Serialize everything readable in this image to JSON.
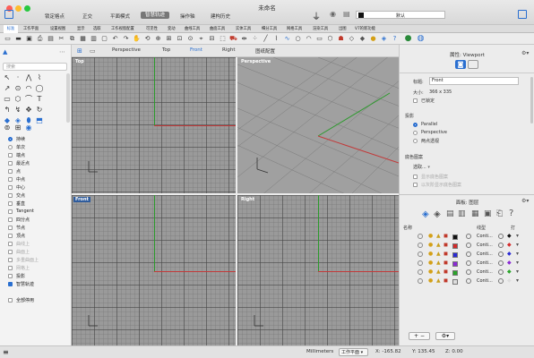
{
  "window": {
    "title": "未命名"
  },
  "modes": [
    "锁定格点",
    "正交",
    "平面模式",
    "智慧轨迹",
    "操作轴",
    "建构历史"
  ],
  "layer_default": "默认",
  "toolbar_tabs": [
    "标准",
    "工作平面",
    "设置视图",
    "显示",
    "选取",
    "工作视窗配置",
    "可见性",
    "变动",
    "曲线工具",
    "曲面工具",
    "实体工具",
    "细分工具",
    "网格工具",
    "渲染工具",
    "出图",
    "V7的新功能"
  ],
  "left": {
    "search_placeholder": "搜索",
    "osnaps": [
      {
        "label": "持续",
        "type": "radio",
        "on": true,
        "disabled": false
      },
      {
        "label": "单次",
        "type": "radio",
        "on": false,
        "disabled": false
      },
      {
        "label": "端点",
        "type": "check",
        "on": false,
        "disabled": false
      },
      {
        "label": "最近点",
        "type": "check",
        "on": false,
        "disabled": false
      },
      {
        "label": "点",
        "type": "check",
        "on": false,
        "disabled": false
      },
      {
        "label": "中点",
        "type": "check",
        "on": false,
        "disabled": false
      },
      {
        "label": "中心",
        "type": "check",
        "on": false,
        "disabled": false
      },
      {
        "label": "交点",
        "type": "check",
        "on": false,
        "disabled": false
      },
      {
        "label": "垂直",
        "type": "check",
        "on": false,
        "disabled": false
      },
      {
        "label": "Tangent",
        "type": "check",
        "on": false,
        "disabled": false
      },
      {
        "label": "四分点",
        "type": "check",
        "on": false,
        "disabled": false
      },
      {
        "label": "节点",
        "type": "check",
        "on": false,
        "disabled": false
      },
      {
        "label": "顶点",
        "type": "check",
        "on": false,
        "disabled": false
      },
      {
        "label": "曲线上",
        "type": "check",
        "on": false,
        "disabled": true
      },
      {
        "label": "曲面上",
        "type": "check",
        "on": false,
        "disabled": true
      },
      {
        "label": "多重曲面上",
        "type": "check",
        "on": false,
        "disabled": true
      },
      {
        "label": "网格上",
        "type": "check",
        "on": false,
        "disabled": true
      },
      {
        "label": "投影",
        "type": "check",
        "on": false,
        "disabled": false
      },
      {
        "label": "智慧轨迹",
        "type": "check",
        "on": true,
        "disabled": false
      },
      {
        "label": "全部停用",
        "type": "check",
        "on": false,
        "disabled": false
      }
    ]
  },
  "viewport_tabs": [
    "Perspective",
    "Top",
    "Front",
    "Right",
    "图纸配置"
  ],
  "active_viewport_tab": "Front",
  "viewports": {
    "top": "Top",
    "perspective": "Perspective",
    "front": "Front",
    "right": "Right"
  },
  "props": {
    "title": "属性: Viewport",
    "title_label": "标题:",
    "title_value": "Front",
    "size_label": "大小:",
    "size_value": "366 x 335",
    "locked": "已锁定",
    "projection_heading": "投影",
    "projections": [
      "Parallel",
      "Perspective",
      "两点透视"
    ],
    "projection_selected": "Parallel",
    "wallpaper_heading": "底色图案",
    "wallpaper_button": "选取...",
    "wallpaper_opts": [
      "显示底色图案",
      "以灰阶显示底色图案"
    ]
  },
  "layers": {
    "title": "面板: 图层",
    "col_name": "名称",
    "col_linetype": "线型",
    "col_print": "打",
    "rows": [
      {
        "linetype": "Conti...",
        "color": "#111111"
      },
      {
        "linetype": "Conti...",
        "color": "#d42a2a"
      },
      {
        "linetype": "Conti...",
        "color": "#2a2ad4"
      },
      {
        "linetype": "Conti...",
        "color": "#8a2ad4"
      },
      {
        "linetype": "Conti...",
        "color": "#2aa42a"
      },
      {
        "linetype": "Conti...",
        "color": "#dddddd"
      }
    ],
    "add": "+",
    "remove": "−"
  },
  "status": {
    "units": "Millimeters",
    "cplane": "工作平面",
    "x": "X: -165.82",
    "y": "Y: 135.45",
    "z": "Z: 0.00"
  }
}
